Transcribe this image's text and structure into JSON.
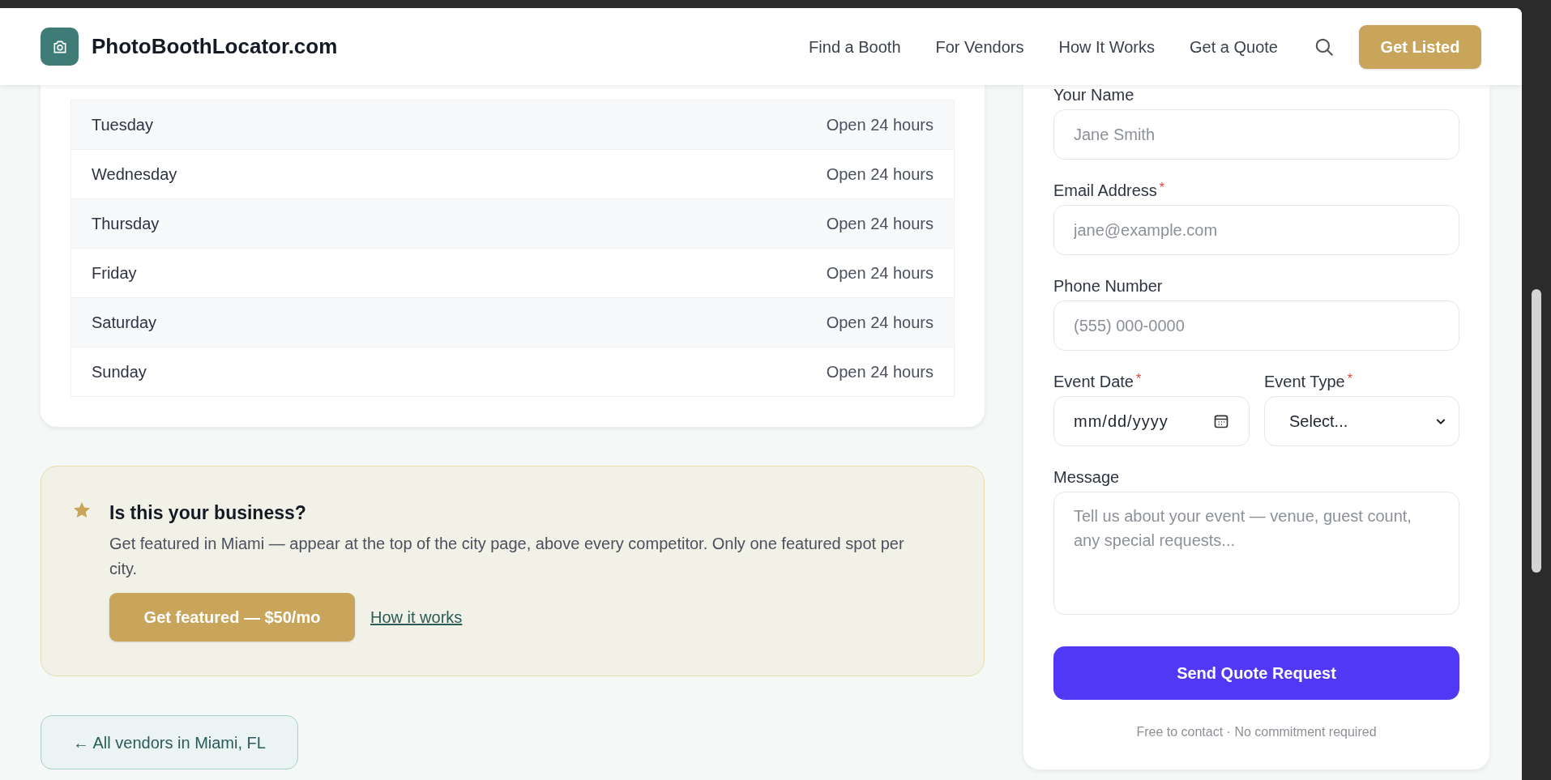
{
  "header": {
    "logo_text": "PhotoBoothLocator.com",
    "nav": [
      {
        "label": "Find a Booth"
      },
      {
        "label": "For Vendors"
      },
      {
        "label": "How It Works"
      },
      {
        "label": "Get a Quote"
      }
    ],
    "cta": "Get Listed"
  },
  "hours": [
    {
      "day": "Tuesday",
      "hours": "Open 24 hours"
    },
    {
      "day": "Wednesday",
      "hours": "Open 24 hours"
    },
    {
      "day": "Thursday",
      "hours": "Open 24 hours"
    },
    {
      "day": "Friday",
      "hours": "Open 24 hours"
    },
    {
      "day": "Saturday",
      "hours": "Open 24 hours"
    },
    {
      "day": "Sunday",
      "hours": "Open 24 hours"
    }
  ],
  "promo": {
    "title": "Is this your business?",
    "text": "Get featured in Miami — appear at the top of the city page, above every competitor. Only one featured spot per city.",
    "button": "Get featured — $50/mo",
    "link": "How it works"
  },
  "back_link": "← All vendors in Miami, FL",
  "form": {
    "required_mark": "*",
    "fields": [
      {
        "label": "Your Name",
        "required": false,
        "placeholder": "Jane Smith"
      },
      {
        "label": "Email Address",
        "required": true,
        "placeholder": "jane@example.com"
      },
      {
        "label": "Phone Number",
        "required": false,
        "placeholder": "(555) 000-0000"
      }
    ],
    "date": {
      "label": "Event Date",
      "required": true,
      "value": "mm/dd/yyyy"
    },
    "type": {
      "label": "Event Type",
      "required": true,
      "value": "Select..."
    },
    "message": {
      "label": "Message",
      "required": false,
      "placeholder": "Tell us about your event — venue, guest count, any special requests..."
    },
    "submit": "Send Quote Request",
    "note": "Free to contact · No commitment required"
  }
}
